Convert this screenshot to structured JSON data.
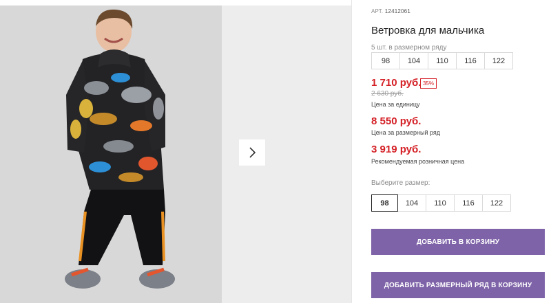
{
  "product": {
    "article_label": "АРТ.",
    "article_number": "12412061",
    "title": "Ветровка для мальчика"
  },
  "set_sizes": {
    "note": "5 шт. в размерном ряду",
    "sizes": [
      "98",
      "104",
      "110",
      "116",
      "122"
    ]
  },
  "pricing": {
    "unit_price": "1 710 руб.",
    "discount": "35%",
    "old_price": "2 630 руб.",
    "unit_caption": "Цена за единицу",
    "set_price": "8 550 руб.",
    "set_caption": "Цена за размерный ряд",
    "rrp_price": "3 919 руб.",
    "rrp_caption": "Рекомендуемая розничная цена"
  },
  "size_picker": {
    "label": "Выберите размер:",
    "selected": "98",
    "sizes": [
      "98",
      "104",
      "110",
      "116",
      "122"
    ]
  },
  "actions": {
    "add_to_cart": "ДОБАВИТЬ В КОРЗИНУ",
    "add_set_to_cart": "ДОБАВИТЬ РАЗМЕРНЫЙ РЯД В КОРЗИНУ"
  },
  "gallery": {
    "next_icon": "chevron-right-icon"
  },
  "colors": {
    "price_red": "#d42026",
    "button_purple": "#7e63a8"
  }
}
